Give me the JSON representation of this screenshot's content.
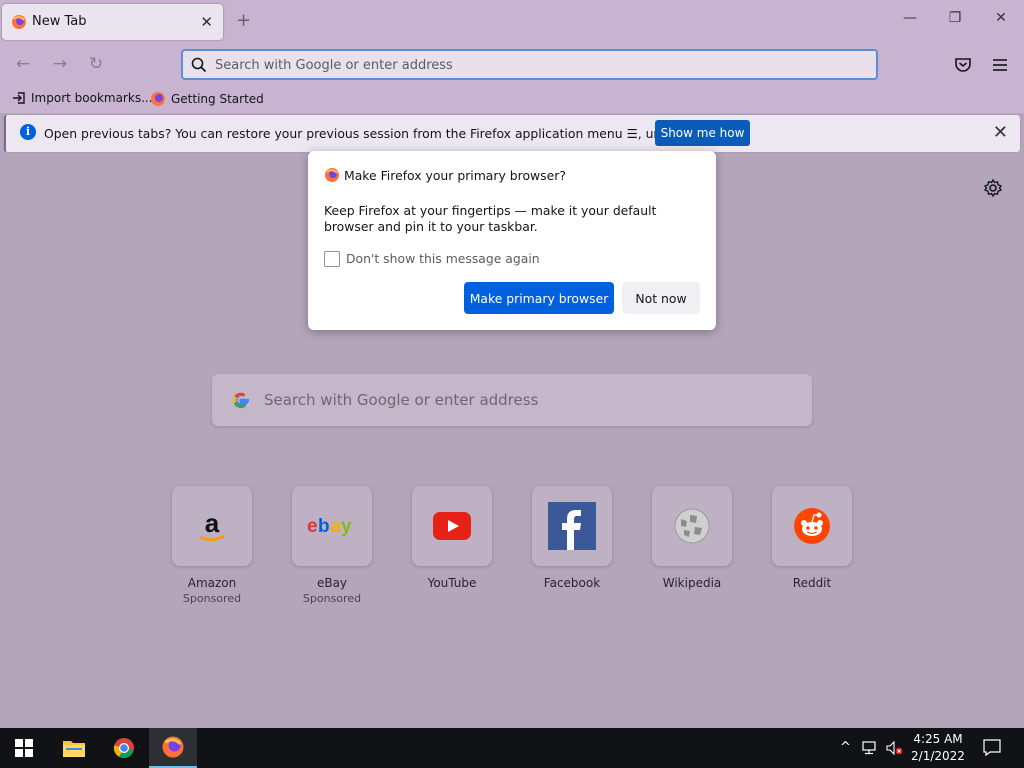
{
  "tab": {
    "title": "New Tab",
    "close": "✕"
  },
  "newtab": "+",
  "window": {
    "minimize": "—",
    "restore": "❐",
    "close": "✕"
  },
  "nav": {
    "back": "←",
    "forward": "→",
    "reload": "↻"
  },
  "urlbar": {
    "placeholder": "Search with Google or enter address"
  },
  "bookmarks": [
    {
      "label": "Import bookmarks..."
    },
    {
      "label": "Getting Started"
    }
  ],
  "notification": {
    "info_icon": "i",
    "message": "Open previous tabs? You can restore your previous session from the Firefox application menu ☰, under History.",
    "button": "Show me how",
    "close": "✕"
  },
  "dialog": {
    "title": "Make Firefox your primary browser?",
    "body": "Keep Firefox at your fingertips — make it your default browser and pin it to your taskbar.",
    "checkbox_label": "Don't show this message again",
    "primary_button": "Make primary browser",
    "secondary_button": "Not now"
  },
  "newtab_search": {
    "placeholder": "Search with Google or enter address"
  },
  "topsites": [
    {
      "name": "Amazon",
      "sponsored": "Sponsored",
      "icon": "amazon-icon"
    },
    {
      "name": "eBay",
      "sponsored": "Sponsored",
      "icon": "ebay-icon"
    },
    {
      "name": "YouTube",
      "sponsored": "",
      "icon": "youtube-icon"
    },
    {
      "name": "Facebook",
      "sponsored": "",
      "icon": "facebook-icon"
    },
    {
      "name": "Wikipedia",
      "sponsored": "",
      "icon": "wikipedia-icon"
    },
    {
      "name": "Reddit",
      "sponsored": "",
      "icon": "reddit-icon"
    }
  ],
  "taskbar": {
    "time": "4:25 AM",
    "date": "2/1/2022",
    "tray_chevron": "^"
  },
  "colors": {
    "accent": "#0060df",
    "toolbar": "#c8b4d0",
    "page_dim": "#b4a5bb",
    "taskbar": "#101215"
  }
}
